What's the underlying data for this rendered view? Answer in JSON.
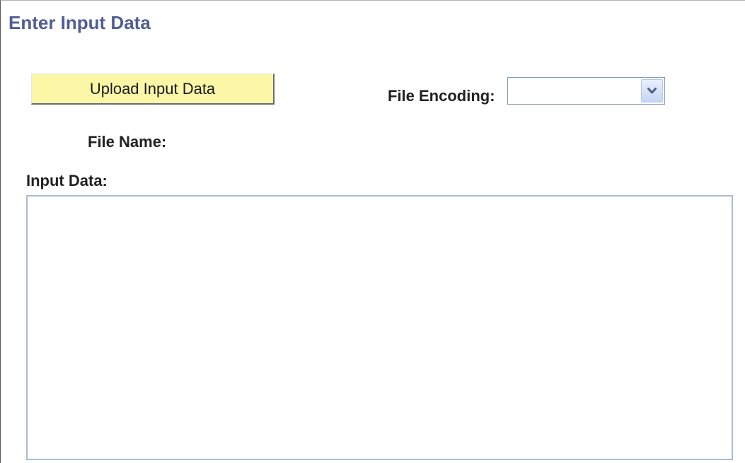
{
  "page": {
    "title": "Enter Input Data"
  },
  "upload": {
    "button_label": "Upload Input Data"
  },
  "file_encoding": {
    "label": "File Encoding:",
    "selected_value": ""
  },
  "file_name": {
    "label": "File Name:",
    "value": ""
  },
  "input_data": {
    "label": "Input Data:",
    "value": ""
  },
  "icons": {
    "dropdown": "chevron-down-icon"
  },
  "colors": {
    "title": "#4f5e96",
    "upload_button_bg": "#fbf7a7",
    "field_border": "#7f9db9"
  }
}
